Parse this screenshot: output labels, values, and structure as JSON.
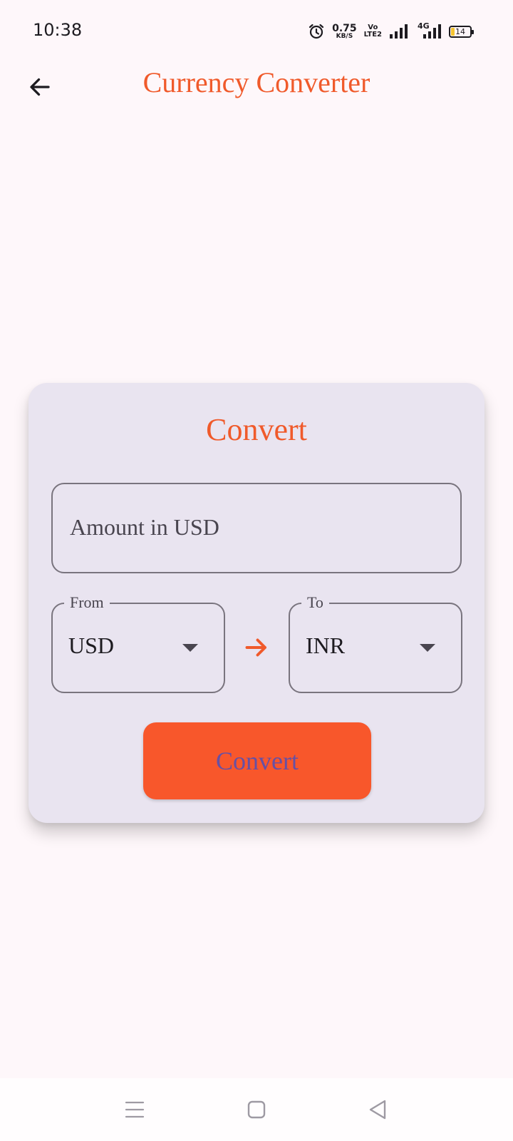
{
  "status_bar": {
    "time": "10:38",
    "net_speed_value": "0.75",
    "net_speed_unit": "KB/S",
    "volte_top": "Vo",
    "volte_bottom": "LTE2",
    "network_label": "4G",
    "battery_level": "14"
  },
  "app_bar": {
    "title": "Currency Converter",
    "back_icon": "arrow-left-icon"
  },
  "card": {
    "title": "Convert",
    "amount_placeholder": "Amount in USD",
    "from": {
      "label": "From",
      "value": "USD"
    },
    "to": {
      "label": "To",
      "value": "INR"
    },
    "swap_icon": "arrow-right-icon",
    "button_label": "Convert"
  },
  "nav_bar": {
    "items": [
      "menu-icon",
      "home-square-icon",
      "back-triangle-icon"
    ]
  },
  "colors": {
    "accent": "#f05a2b",
    "button": "#f8572b",
    "button_text": "#6750a4",
    "card_bg": "#e9e4f0",
    "page_bg": "#fef7fa"
  }
}
